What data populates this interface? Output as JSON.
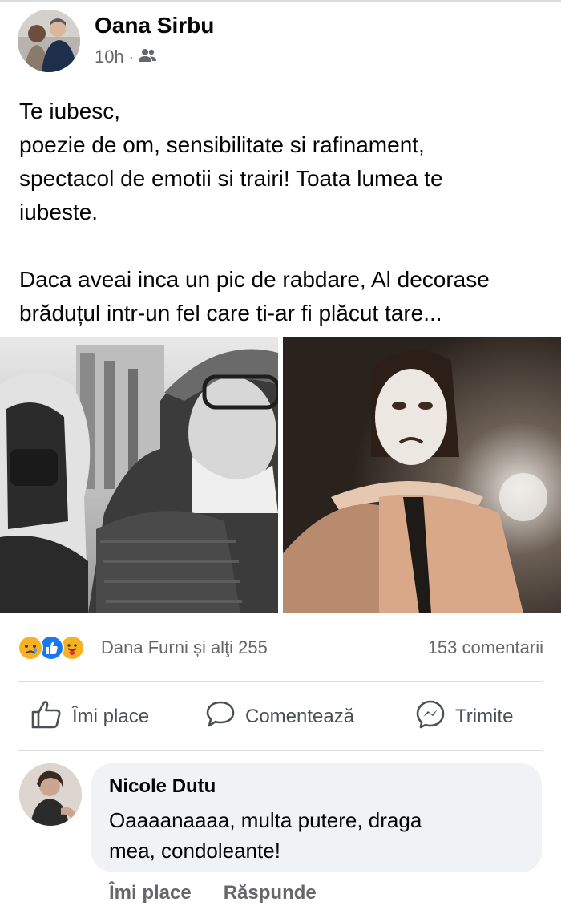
{
  "post": {
    "author": "Oana Sirbu",
    "time": "10h",
    "separator": "·",
    "audience_icon": "friends-icon",
    "text": "Te iubesc,\npoezie de om, sensibilitate si rafinament,\nspectacol de emotii si trairi! Toata lumea te\niubeste.\n\nDaca aveai inca un pic de rabdare, Al decorase\nbrăduțul intr-un fel care ti-ar fi plăcut tare..."
  },
  "reactions": {
    "icons": [
      "sad-reaction-icon",
      "like-reaction-icon",
      "care-reaction-icon"
    ],
    "summary": "Dana Furni și alţi 255",
    "comments": "153 comentarii"
  },
  "actions": {
    "like": "Îmi place",
    "comment": "Comentează",
    "share": "Trimite"
  },
  "comment": {
    "author": "Nicole Dutu",
    "text": "Oaaaanaaaa, multa putere, draga\nmea, condoleante!",
    "like": "Îmi place",
    "reply": "Răspunde"
  },
  "colors": {
    "like_blue": "#1877f2",
    "sad_yellow": "#f7b125",
    "secondary_text": "#65676b"
  }
}
